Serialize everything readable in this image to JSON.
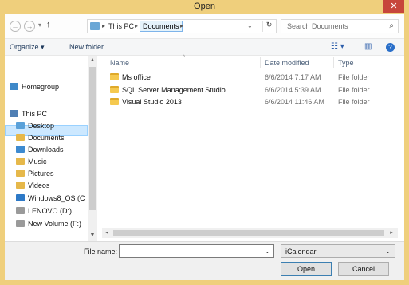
{
  "window": {
    "title": "Open",
    "close_glyph": "✕"
  },
  "address": {
    "back_glyph": "←",
    "forward_glyph": "→",
    "recent_glyph": "▾",
    "up_glyph": "↑",
    "crumbs": [
      "This PC",
      "Documents"
    ],
    "crumb_sep": "▸",
    "dropdown_glyph": "⌄",
    "refresh_glyph": "↻"
  },
  "search": {
    "placeholder": "Search Documents",
    "icon": "⌕"
  },
  "toolbar": {
    "organize": "Organize ▾",
    "new_folder": "New folder",
    "view_icon": "☷ ▾",
    "pane_icon": "▥",
    "help_icon": "?"
  },
  "nav": {
    "items": [
      {
        "label": "Homegroup",
        "icon": "homegroup-icon",
        "color": "#3f89c9"
      },
      {
        "label": "This PC",
        "icon": "computer-icon",
        "color": "#4f7fb4"
      },
      {
        "label": "Desktop",
        "icon": "desktop-folder-icon",
        "color": "#5aa1d9"
      },
      {
        "label": "Documents",
        "icon": "documents-folder-icon",
        "color": "#e6b84a"
      },
      {
        "label": "Downloads",
        "icon": "downloads-folder-icon",
        "color": "#3d8ad0"
      },
      {
        "label": "Music",
        "icon": "music-folder-icon",
        "color": "#e6b84a"
      },
      {
        "label": "Pictures",
        "icon": "pictures-folder-icon",
        "color": "#e6b84a"
      },
      {
        "label": "Videos",
        "icon": "videos-folder-icon",
        "color": "#e6b84a"
      },
      {
        "label": "Windows8_OS (C",
        "icon": "windows-drive-icon",
        "color": "#2d79c7"
      },
      {
        "label": "LENOVO (D:)",
        "icon": "drive-icon",
        "color": "#9a9a9a"
      },
      {
        "label": "New Volume (F:)",
        "icon": "drive-icon",
        "color": "#9a9a9a"
      }
    ],
    "scroll_up": "▲",
    "scroll_down": "▼"
  },
  "files": {
    "columns": {
      "name": "Name",
      "date": "Date modified",
      "type": "Type"
    },
    "sort_glyph": "^",
    "rows": [
      {
        "name": "Ms office",
        "date": "6/6/2014 7:17 AM",
        "type": "File folder"
      },
      {
        "name": "SQL Server Management Studio",
        "date": "6/6/2014 5:39 AM",
        "type": "File folder"
      },
      {
        "name": "Visual Studio 2013",
        "date": "6/6/2014 11:46 AM",
        "type": "File folder"
      }
    ],
    "scroll_left": "◂",
    "scroll_right": "▸"
  },
  "bottom": {
    "file_name_label": "File name:",
    "file_name_value": "",
    "file_name_drop": "⌄",
    "file_type": "iCalendar",
    "file_type_arrow": "⌄",
    "open_label": "Open",
    "cancel_label": "Cancel"
  }
}
